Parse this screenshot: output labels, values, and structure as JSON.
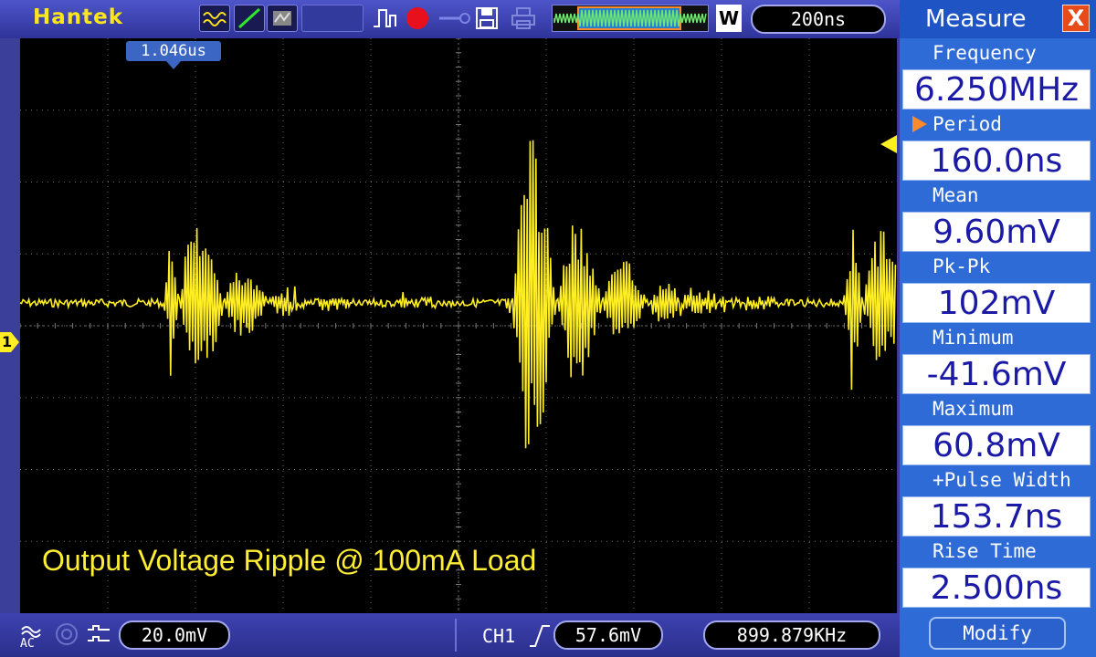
{
  "app": {
    "brand": "Hantek"
  },
  "toolbar": {
    "timebase": "200ns",
    "waveform_mode": "W",
    "icons": [
      "math-wave-icon",
      "line-draw-icon",
      "persistence-icon",
      "pulse-trigger-icon",
      "record-icon",
      "probe-icon",
      "save-icon",
      "print-icon",
      "zoom-wave-icon"
    ]
  },
  "screen": {
    "cursor_time": "1.046us",
    "channel_marker": "1",
    "caption": "Output Voltage Ripple @ 100mA Load",
    "trace_color": "#ffee22"
  },
  "status": {
    "coupling": "AC",
    "volts_per_div": "20.0mV",
    "trigger_channel": "CH1",
    "trigger_level": "57.6mV",
    "frequency": "899.879KHz"
  },
  "measure": {
    "title": "Measure",
    "close": "X",
    "items": [
      {
        "label": "Frequency",
        "value": "6.250MHz"
      },
      {
        "label": "Period",
        "value": "160.0ns",
        "selected": true
      },
      {
        "label": "Mean",
        "value": "9.60mV"
      },
      {
        "label": "Pk-Pk",
        "value": "102mV"
      },
      {
        "label": "Minimum",
        "value": "-41.6mV"
      },
      {
        "label": "Maximum",
        "value": "60.8mV"
      },
      {
        "label": "+Pulse Width",
        "value": "153.7ns"
      },
      {
        "label": "Rise Time",
        "value": "2.500ns"
      }
    ],
    "modify": "Modify"
  }
}
